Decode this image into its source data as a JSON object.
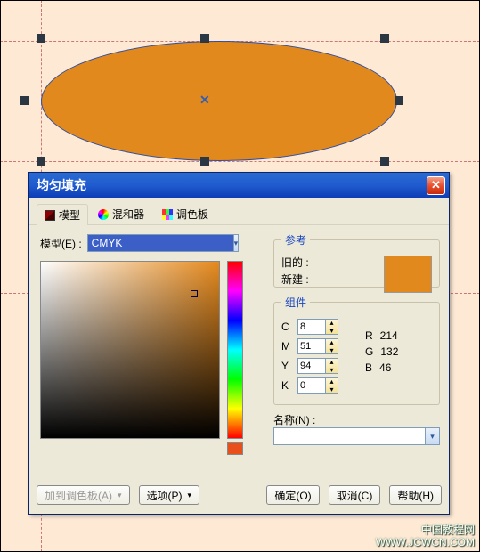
{
  "dialog": {
    "title": "均匀填充"
  },
  "tabs": {
    "model": "模型",
    "mixer": "混和器",
    "palette": "调色板"
  },
  "model": {
    "label": "模型(E) :",
    "value": "CMYK"
  },
  "ref": {
    "legend": "参考",
    "old": "旧的 :",
    "new": "新建 :"
  },
  "comp": {
    "legend": "组件",
    "c_label": "C",
    "c": "8",
    "m_label": "M",
    "m": "51",
    "y_label": "Y",
    "y": "94",
    "k_label": "K",
    "k": "0",
    "r_label": "R",
    "r": "214",
    "g_label": "G",
    "g": "132",
    "b_label": "B",
    "b": "46"
  },
  "name": {
    "label": "名称(N) :",
    "value": ""
  },
  "buttons": {
    "addpalette": "加到调色板(A)",
    "options": "选项(P)",
    "ok": "确定(O)",
    "cancel": "取消(C)",
    "help": "帮助(H)"
  },
  "watermark": {
    "l1": "中国教程网",
    "l2": "WWW.JCWCN.COM"
  }
}
